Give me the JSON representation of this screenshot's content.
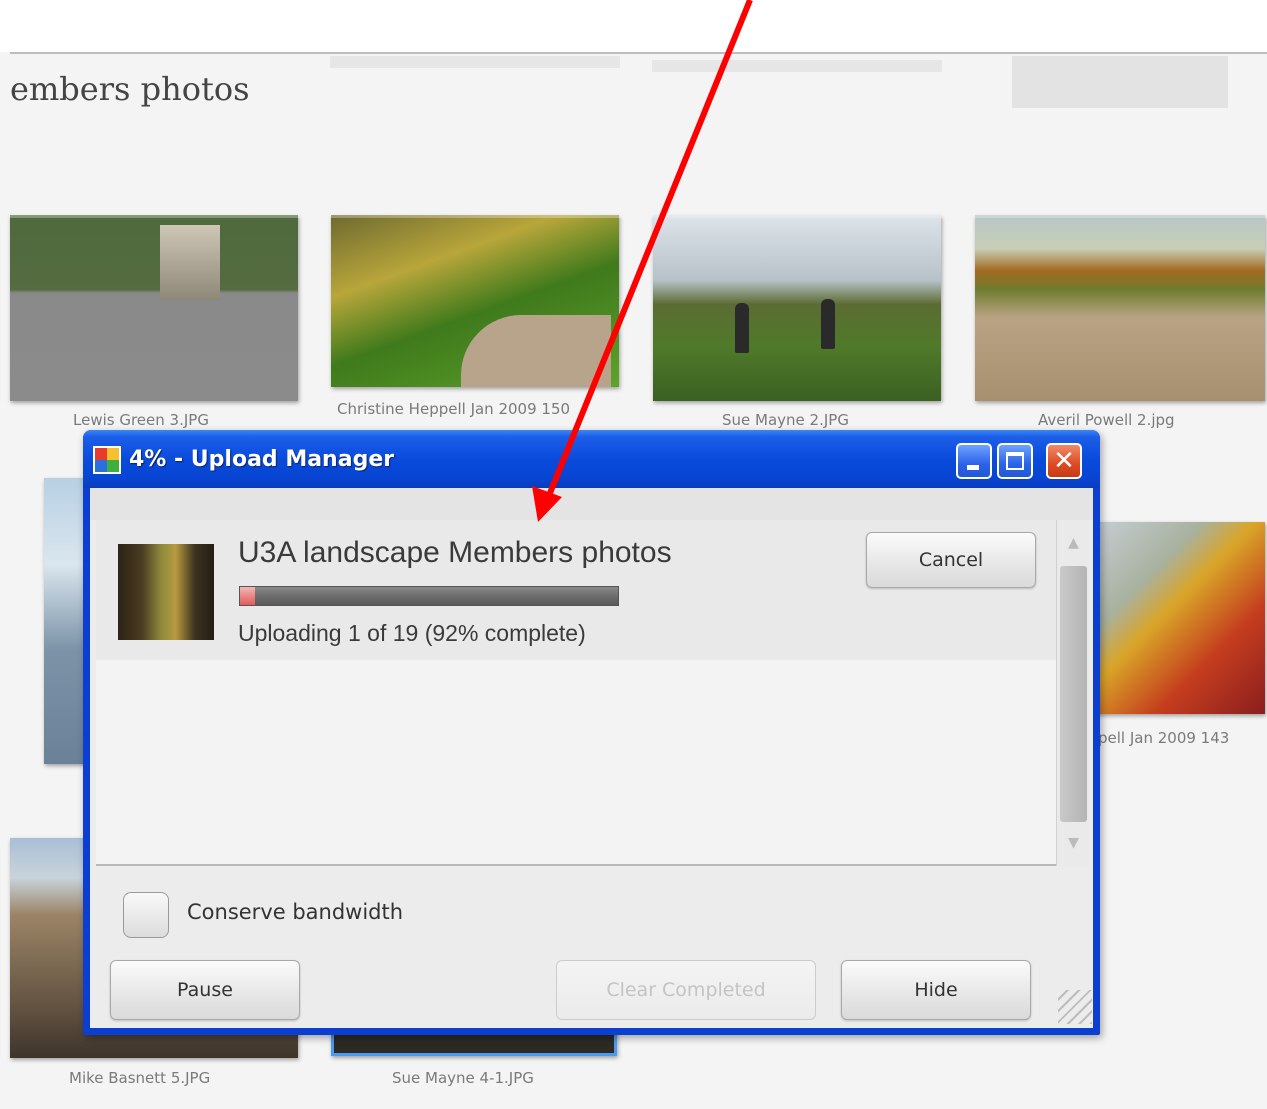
{
  "background": {
    "page_title": "embers photos",
    "captions": {
      "lewis_green_3": "Lewis Green 3.JPG",
      "christine_heppell_150": "Christine Heppell Jan 2009 150",
      "sue_mayne_2": "Sue Mayne 2.JPG",
      "averil_powell_2": "Averil Powell 2.jpg",
      "heppell_143": "pell Jan 2009 143",
      "mike_basnett_5": "Mike Basnett 5.JPG",
      "sue_mayne_4_1": "Sue Mayne 4-1.JPG"
    }
  },
  "window": {
    "title": "4% - Upload Manager",
    "title_progress_percent": 4,
    "controls": {
      "minimize_icon": "minimize-icon",
      "maximize_icon": "maximize-icon",
      "close_icon": "close-icon",
      "close_glyph": "✕"
    }
  },
  "upload": {
    "album_name": "U3A landscape Members photos",
    "status": "Uploading 1 of 19 (92% complete)",
    "progress_fraction": 0.04,
    "cancel_label": "Cancel"
  },
  "scrollbar": {
    "up_glyph": "▲",
    "down_glyph": "▼"
  },
  "footer": {
    "conserve_bandwidth_label": "Conserve bandwidth",
    "conserve_bandwidth_checked": false,
    "pause_label": "Pause",
    "clear_completed_label": "Clear Completed",
    "hide_label": "Hide"
  },
  "colors": {
    "titlebar": "#0a4bdc",
    "close_button": "#dd4b22",
    "annotation_arrow": "#ff0000",
    "progress_fill": "#e05a5a"
  }
}
